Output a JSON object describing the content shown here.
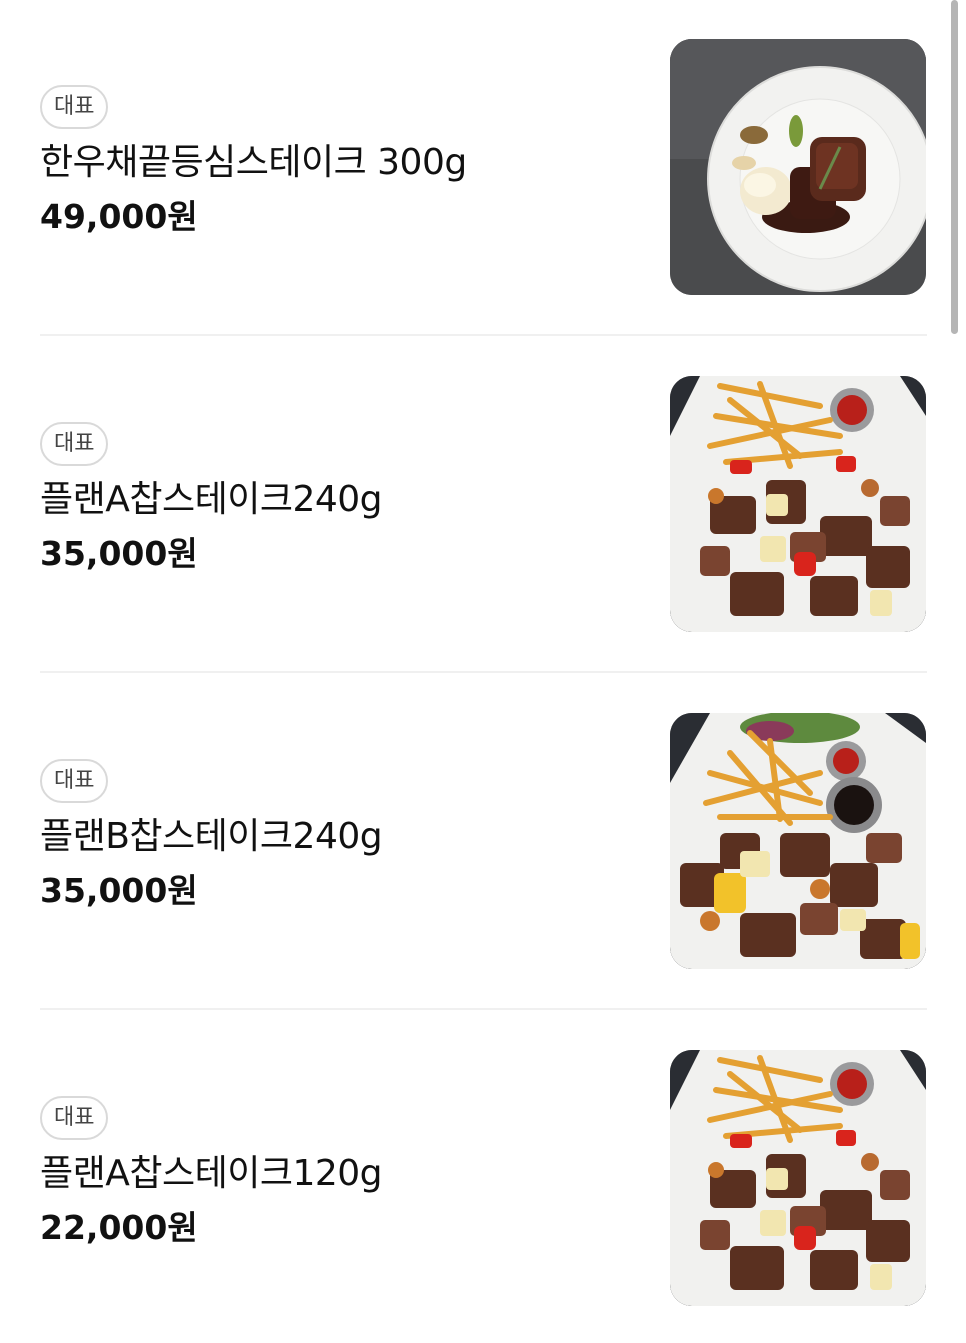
{
  "menu": {
    "items": [
      {
        "badge": "대표",
        "name": "한우채끝등심스테이크 300g",
        "price": "49,000원",
        "photo_icon": "steak-plate-photo"
      },
      {
        "badge": "대표",
        "name": "플랜A찹스테이크240g",
        "price": "35,000원",
        "photo_icon": "chop-steak-photo"
      },
      {
        "badge": "대표",
        "name": "플랜B찹스테이크240g",
        "price": "35,000원",
        "photo_icon": "chop-steak-photo"
      },
      {
        "badge": "대표",
        "name": "플랜A찹스테이크120g",
        "price": "22,000원",
        "photo_icon": "chop-steak-photo"
      }
    ]
  },
  "colors": {
    "divider": "#f0f0f0",
    "badge_border": "#d9d9d9",
    "text": "#111111"
  }
}
